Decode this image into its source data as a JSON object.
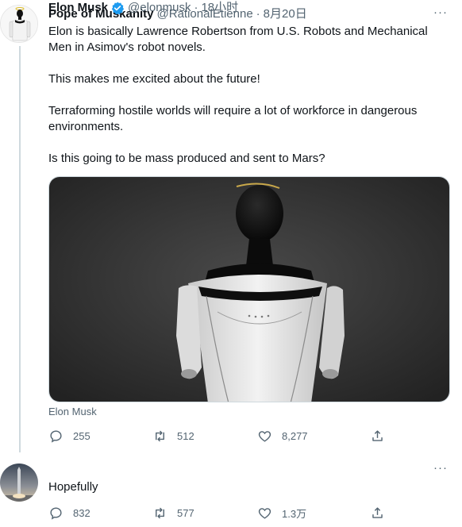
{
  "tweet1": {
    "name": "Pope of Muskanity",
    "handle": "@RationalEtienne",
    "separator": "·",
    "time": "8月20日",
    "paragraphs": [
      "Elon is basically Lawrence Robertson from U.S. Robots and Mechanical Men in Asimov's robot novels.",
      "This makes me excited about the future!",
      "Terraforming hostile worlds will require a lot of workforce in dangerous environments.",
      "Is this going to be mass produced and sent to Mars?"
    ],
    "media_caption": "Elon Musk",
    "replies": "255",
    "retweets": "512",
    "likes": "8,277",
    "more": "···"
  },
  "tweet2": {
    "name": "Elon Musk",
    "handle": "@elonmusk",
    "separator": "·",
    "time": "18小时",
    "text": "Hopefully",
    "replies": "832",
    "retweets": "577",
    "likes": "1.3万",
    "more": "···"
  },
  "colors": {
    "secondary": "#536471",
    "verified": "#1d9bf0",
    "thread_line": "#cfd9de"
  },
  "icons": [
    "reply-icon",
    "retweet-icon",
    "like-icon",
    "share-icon",
    "verified-badge-icon",
    "more-icon"
  ]
}
